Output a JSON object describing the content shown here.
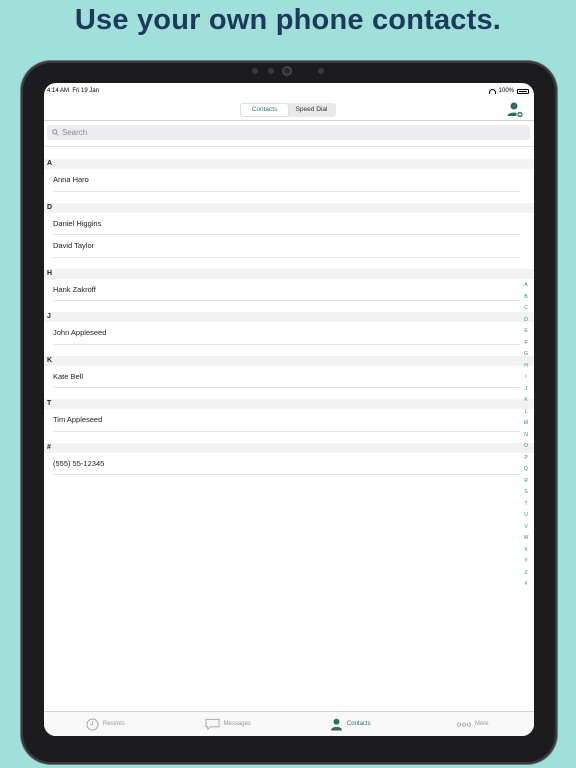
{
  "headline": "Use your own phone contacts.",
  "status": {
    "time": "4:14 AM",
    "date": "Fri 19 Jan",
    "battery": "100%"
  },
  "segments": [
    "Contacts",
    "Speed Dial"
  ],
  "search": {
    "placeholder": "Search"
  },
  "sections": [
    {
      "letter": "A",
      "contacts": [
        "Anna Haro"
      ]
    },
    {
      "letter": "D",
      "contacts": [
        "Daniel Higgins",
        "David Taylor"
      ]
    },
    {
      "letter": "H",
      "contacts": [
        "Hank Zakroff"
      ]
    },
    {
      "letter": "J",
      "contacts": [
        "John Appleseed"
      ]
    },
    {
      "letter": "K",
      "contacts": [
        "Kate Bell"
      ]
    },
    {
      "letter": "T",
      "contacts": [
        "Tim Appleseed"
      ]
    },
    {
      "letter": "#",
      "contacts": [
        "(555) 55-12345"
      ]
    }
  ],
  "index_letters": [
    "A",
    "B",
    "C",
    "D",
    "E",
    "F",
    "G",
    "H",
    "I",
    "J",
    "K",
    "L",
    "M",
    "N",
    "O",
    "P",
    "Q",
    "R",
    "S",
    "T",
    "U",
    "V",
    "W",
    "X",
    "Y",
    "Z",
    "#"
  ],
  "tabs": [
    {
      "label": "Recents",
      "icon": "clock-icon"
    },
    {
      "label": "Messages",
      "icon": "message-icon"
    },
    {
      "label": "Contacts",
      "icon": "person-icon"
    },
    {
      "label": "More",
      "icon": "more-icon"
    }
  ],
  "colors": {
    "background": "#a1dfda",
    "headline": "#1b3a5c",
    "accent": "#2b6c63"
  }
}
